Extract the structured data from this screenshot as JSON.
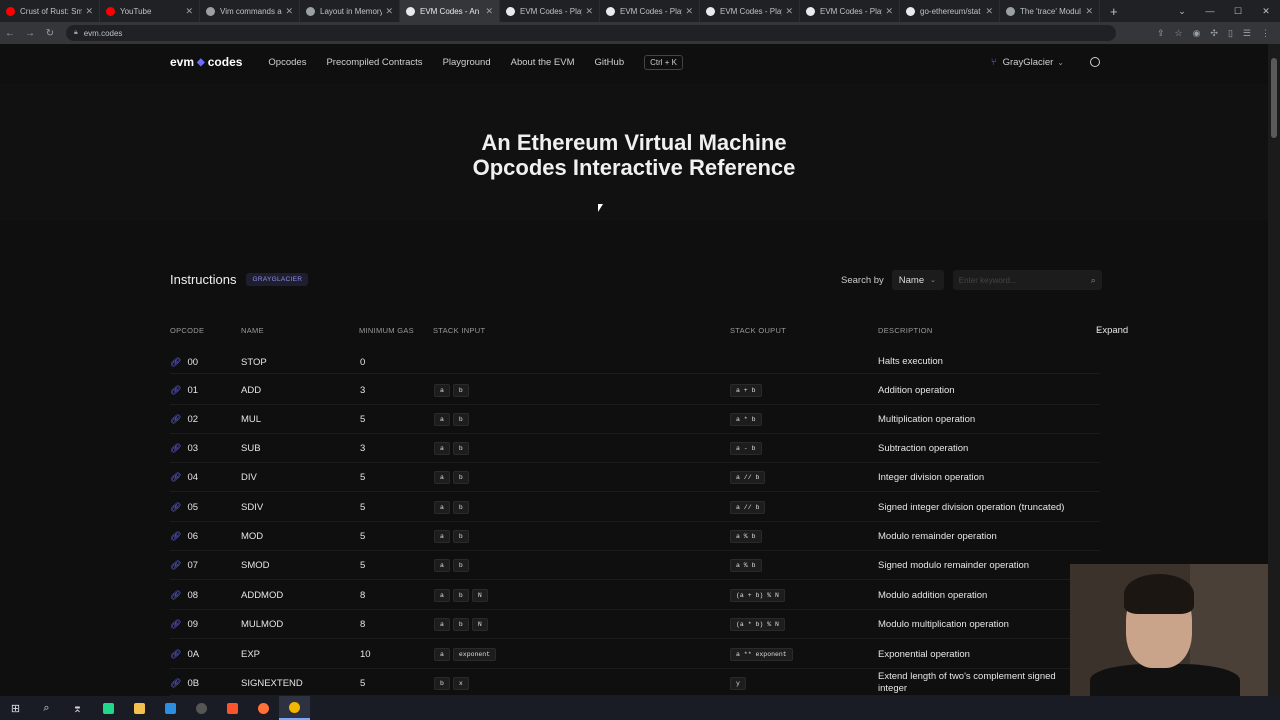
{
  "browser": {
    "tabs": [
      {
        "title": "Crust of Rust: Sm",
        "color": "#ff0000"
      },
      {
        "title": "YouTube",
        "color": "#ff0000"
      },
      {
        "title": "Vim commands ar",
        "color": "#9aa0a6"
      },
      {
        "title": "Layout in Memory",
        "color": "#9aa0a6"
      },
      {
        "title": "EVM Codes - An E",
        "color": "#e8eaed"
      },
      {
        "title": "EVM Codes - Play",
        "color": "#e8eaed"
      },
      {
        "title": "EVM Codes - Play",
        "color": "#e8eaed"
      },
      {
        "title": "EVM Codes - Play",
        "color": "#e8eaed"
      },
      {
        "title": "EVM Codes - Play",
        "color": "#e8eaed"
      },
      {
        "title": "go-ethereum/stat",
        "color": "#e8eaed"
      },
      {
        "title": "The 'trace' Modul",
        "color": "#9aa0a6"
      }
    ],
    "url": "evm.codes"
  },
  "nav": {
    "logo_left": "evm",
    "logo_right": "codes",
    "links": [
      "Opcodes",
      "Precompiled Contracts",
      "Playground",
      "About the EVM",
      "GitHub"
    ],
    "shortcut": "Ctrl + K",
    "fork": "GrayGlacier"
  },
  "hero": {
    "line1": "An Ethereum Virtual Machine",
    "line2": "Opcodes Interactive Reference"
  },
  "instructions": {
    "title": "Instructions",
    "badge": "GRAYGLACIER",
    "search_by_label": "Search by",
    "search_by_value": "Name",
    "search_placeholder": "Enter keyword..."
  },
  "table": {
    "headers": {
      "opcode": "OPCODE",
      "name": "NAME",
      "gas": "MINIMUM GAS",
      "input": "STACK INPUT",
      "output": "STACK OUPUT",
      "desc": "DESCRIPTION",
      "expand": "Expand"
    },
    "rows": [
      {
        "op": "00",
        "name": "STOP",
        "gas": "0",
        "input": [],
        "output": [],
        "desc": "Halts execution"
      },
      {
        "op": "01",
        "name": "ADD",
        "gas": "3",
        "input": [
          "a",
          "b"
        ],
        "output": [
          "a + b"
        ],
        "desc": "Addition operation"
      },
      {
        "op": "02",
        "name": "MUL",
        "gas": "5",
        "input": [
          "a",
          "b"
        ],
        "output": [
          "a * b"
        ],
        "desc": "Multiplication operation"
      },
      {
        "op": "03",
        "name": "SUB",
        "gas": "3",
        "input": [
          "a",
          "b"
        ],
        "output": [
          "a - b"
        ],
        "desc": "Subtraction operation"
      },
      {
        "op": "04",
        "name": "DIV",
        "gas": "5",
        "input": [
          "a",
          "b"
        ],
        "output": [
          "a // b"
        ],
        "desc": "Integer division operation"
      },
      {
        "op": "05",
        "name": "SDIV",
        "gas": "5",
        "input": [
          "a",
          "b"
        ],
        "output": [
          "a // b"
        ],
        "desc": "Signed integer division operation (truncated)"
      },
      {
        "op": "06",
        "name": "MOD",
        "gas": "5",
        "input": [
          "a",
          "b"
        ],
        "output": [
          "a % b"
        ],
        "desc": "Modulo remainder operation"
      },
      {
        "op": "07",
        "name": "SMOD",
        "gas": "5",
        "input": [
          "a",
          "b"
        ],
        "output": [
          "a % b"
        ],
        "desc": "Signed modulo remainder operation"
      },
      {
        "op": "08",
        "name": "ADDMOD",
        "gas": "8",
        "input": [
          "a",
          "b",
          "N"
        ],
        "output": [
          "(a + b) % N"
        ],
        "desc": "Modulo addition operation"
      },
      {
        "op": "09",
        "name": "MULMOD",
        "gas": "8",
        "input": [
          "a",
          "b",
          "N"
        ],
        "output": [
          "(a * b) % N"
        ],
        "desc": "Modulo multiplication operation"
      },
      {
        "op": "0A",
        "name": "EXP",
        "gas": "10",
        "input": [
          "a",
          "exponent"
        ],
        "output": [
          "a ** exponent"
        ],
        "desc": "Exponential operation"
      },
      {
        "op": "0B",
        "name": "SIGNEXTEND",
        "gas": "5",
        "input": [
          "b",
          "x"
        ],
        "output": [
          "y"
        ],
        "desc": "Extend length of two's complement signed integer"
      }
    ]
  },
  "colors": {
    "accent": "#6c6cff",
    "background": "#0f0f0f"
  }
}
